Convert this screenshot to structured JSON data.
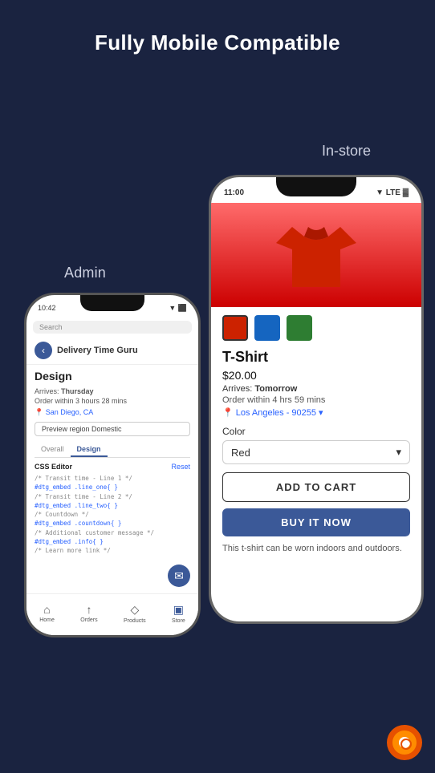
{
  "page": {
    "title": "Fully Mobile Compatible",
    "bg_color": "#1a2340"
  },
  "labels": {
    "admin": "Admin",
    "instore": "In-store"
  },
  "admin_phone": {
    "status_time": "10:42",
    "status_signal": "▼",
    "nav_title": "Delivery Time Guru",
    "back_label": "‹",
    "search_placeholder": "Search",
    "section_title": "Design",
    "arrives_label": "Arrives:",
    "arrives_day": "Thursday",
    "order_within": "Order within 3 hours 28 mins",
    "location": "San Diego, CA",
    "preview_label": "Preview region Domestic",
    "tab_overall": "Overall",
    "tab_design": "Design",
    "css_editor_title": "CSS Editor",
    "css_editor_reset": "Reset",
    "css_lines": [
      "/* Transit time - Line 1 */",
      "#dtg_embed .line_one{ }",
      "/* Transit time - Line 2 */",
      "#dtg_embed .line_two{ }",
      "/* Countdown */",
      "#dtg_embed .countdown{ }",
      "/* Additional customer message */",
      "#dtg_embed .info{ }",
      "/* Learn more link */",
      ""
    ],
    "fab_icon": "✉",
    "bottom_nav": [
      {
        "label": "Home",
        "icon": "⌂"
      },
      {
        "label": "Orders",
        "icon": "↑"
      },
      {
        "label": "Products",
        "icon": "◇"
      },
      {
        "label": "Store",
        "icon": "▣"
      }
    ]
  },
  "instore_phone": {
    "status_time": "11:00",
    "status_right": "LTE ▓",
    "product_name": "T-Shirt",
    "product_price": "$20.00",
    "arrives_label": "Arrives:",
    "arrives_day": "Tomorrow",
    "order_within": "Order within 4 hrs 59 mins",
    "location": "Los Angeles - 90255",
    "color_label": "Color",
    "color_selected": "Red",
    "swatches": [
      {
        "name": "red",
        "selected": true
      },
      {
        "name": "blue",
        "selected": false
      },
      {
        "name": "green",
        "selected": false
      }
    ],
    "add_to_cart": "ADD TO CART",
    "buy_it_now": "BUY IT NOW",
    "product_desc": "This t-shirt can be worn indoors and outdoors."
  },
  "speed_dial": {
    "label": "speed-dial-icon"
  }
}
